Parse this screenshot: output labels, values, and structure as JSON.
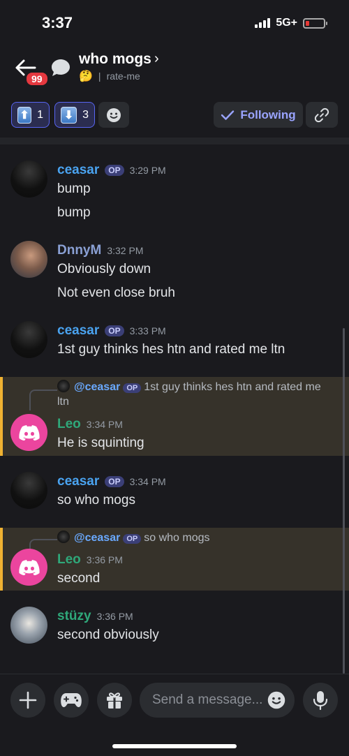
{
  "status": {
    "time": "3:37",
    "network": "5G+"
  },
  "header": {
    "badge": "99",
    "title": "who mogs",
    "chevron": "›",
    "emoji": "🤔",
    "separator": "|",
    "channel": "rate-me"
  },
  "reactions": {
    "up_glyph": "⬆",
    "up_count": "1",
    "down_glyph": "⬇",
    "down_count": "3",
    "following_label": "Following"
  },
  "messages": [
    {
      "author": "ceasar",
      "op": "OP",
      "time": "3:29 PM",
      "lines": [
        "bump",
        "bump"
      ]
    },
    {
      "author": "DnnyM",
      "time": "3:32 PM",
      "lines": [
        "Obviously down",
        "Not even close bruh"
      ]
    },
    {
      "author": "ceasar",
      "op": "OP",
      "time": "3:33 PM",
      "lines": [
        "1st guy thinks hes htn and rated me ltn"
      ]
    },
    {
      "reply_to": "@ceasar",
      "reply_op": "OP",
      "reply_text_1": "1st guy thinks hes htn and rated me",
      "reply_text_2": "ltn",
      "author": "Leo",
      "time": "3:34 PM",
      "lines": [
        "He is squinting"
      ]
    },
    {
      "author": "ceasar",
      "op": "OP",
      "time": "3:34 PM",
      "lines": [
        "so who mogs"
      ]
    },
    {
      "reply_to": "@ceasar",
      "reply_op": "OP",
      "reply_text_1": "so who mogs",
      "author": "Leo",
      "time": "3:36 PM",
      "lines": [
        "second"
      ]
    },
    {
      "author": "stüzy",
      "time": "3:36 PM",
      "lines": [
        "second obviously"
      ]
    }
  ],
  "composer": {
    "placeholder": "Send a message..."
  },
  "colors": {
    "ceasar": "#4aa3f0",
    "dnny": "#8aa0d4",
    "leo": "#2fa87a",
    "stuzy": "#2fa87a",
    "highlight_border": "#f0b232",
    "accent": "#5865f2"
  }
}
